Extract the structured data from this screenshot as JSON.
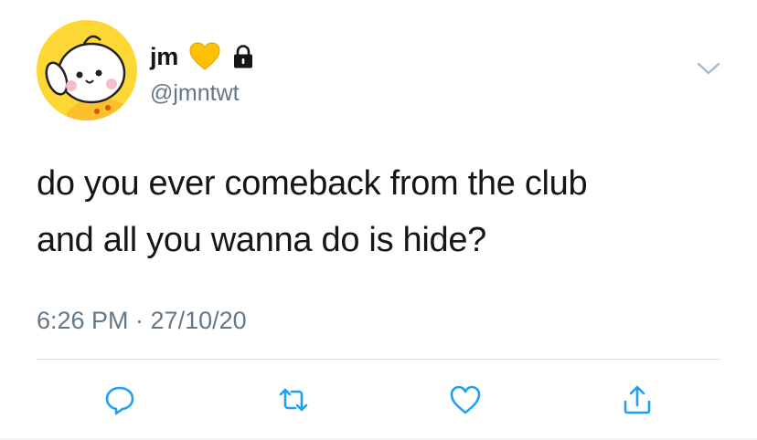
{
  "tweet": {
    "author": {
      "display_name": "jm",
      "handle": "@jmntwt",
      "avatar": "chimmy-avatar",
      "badges": [
        "yellow-heart-icon",
        "lock-icon"
      ]
    },
    "text_lines": [
      "do you ever comeback from the club",
      "and all you wanna do is hide?"
    ],
    "timestamp": "6:26 PM · 27/10/20",
    "actions": [
      "reply-icon",
      "retweet-icon",
      "like-icon",
      "share-icon"
    ]
  },
  "colors": {
    "text": "#14171a",
    "secondary": "#657786",
    "icon": "#1da1f2",
    "heart": "#ffc107",
    "avatar_bg": "#fcd34d"
  }
}
